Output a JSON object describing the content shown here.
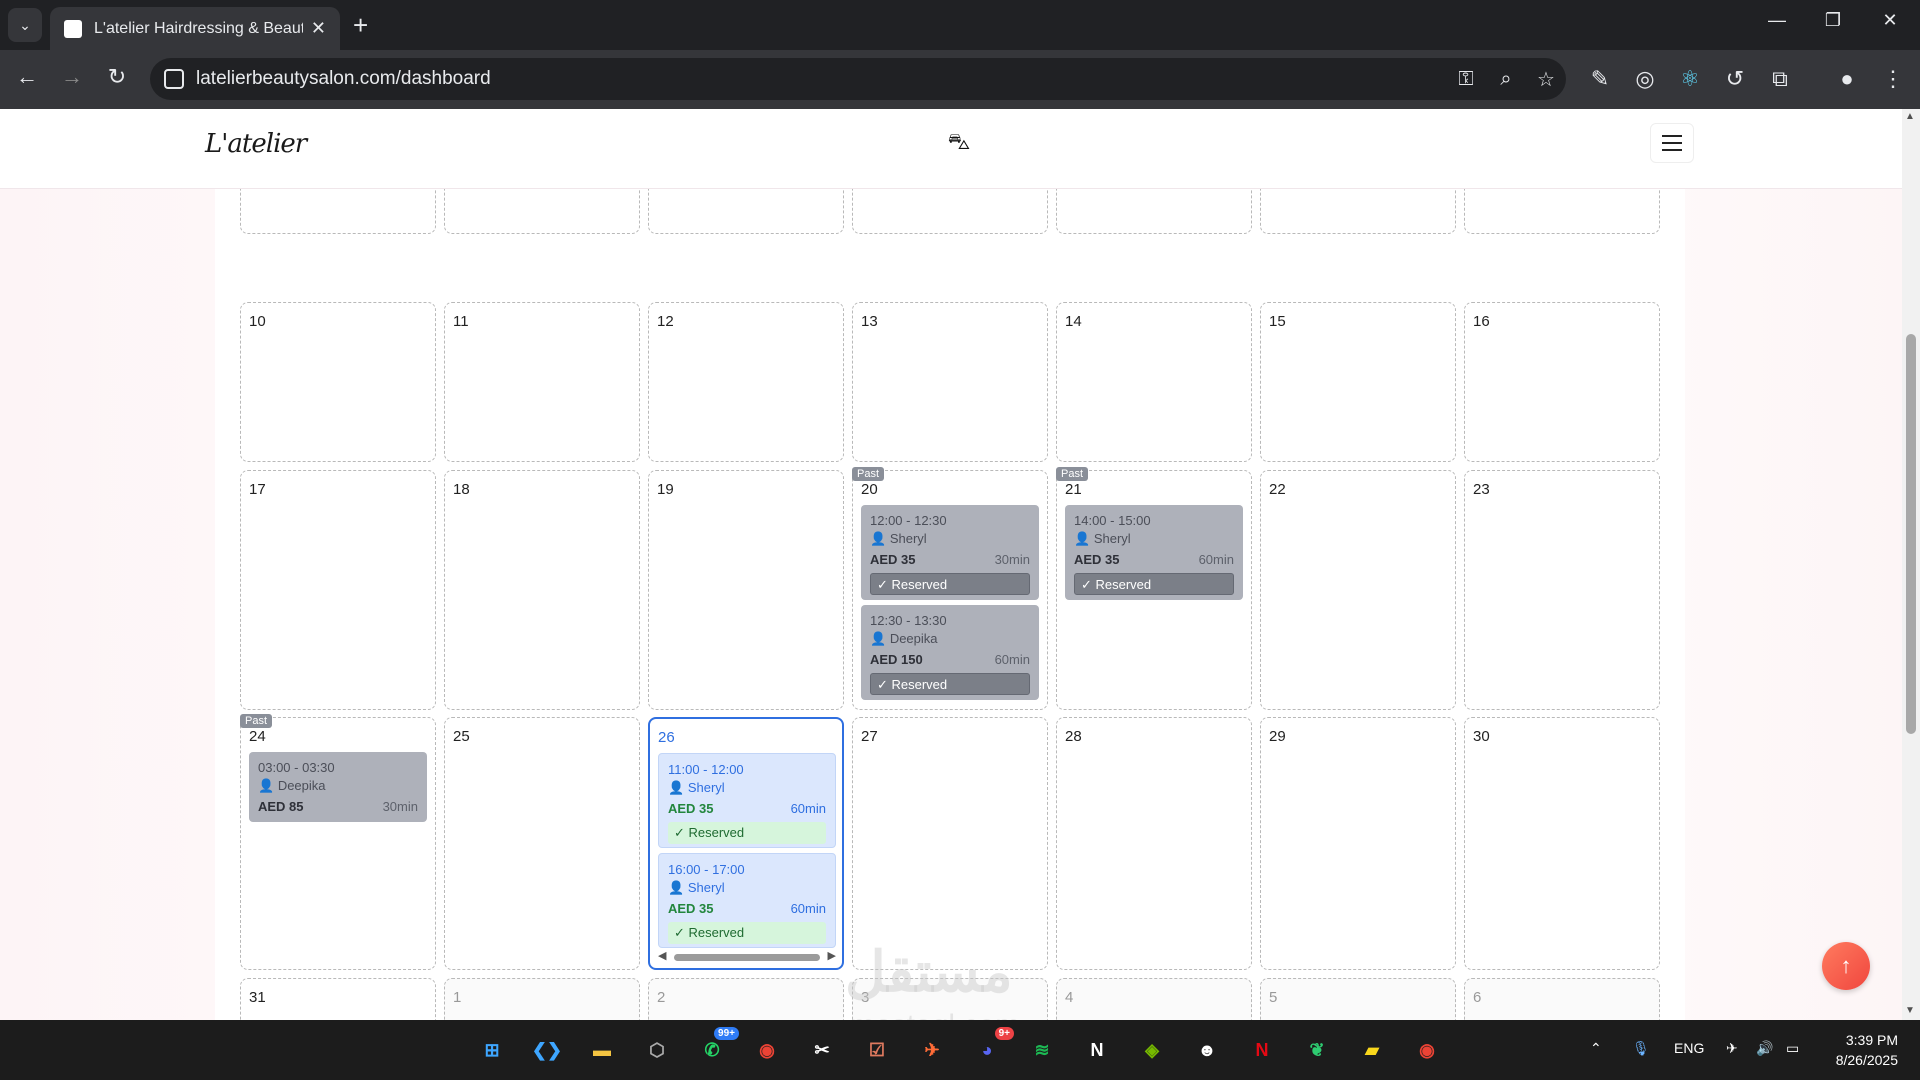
{
  "browser": {
    "tab_title": "L'atelier Hairdressing & Beauty",
    "url": "latelierbeautysalon.com/dashboard"
  },
  "site": {
    "logo": "L'atelier"
  },
  "calendar": {
    "rows": [
      {
        "days": [
          {
            "num": "",
            "muted": false
          },
          {
            "num": "",
            "muted": false
          },
          {
            "num": "",
            "muted": false
          },
          {
            "num": "",
            "muted": false
          },
          {
            "num": "",
            "muted": false
          },
          {
            "num": "",
            "muted": false
          },
          {
            "num": "",
            "muted": false
          }
        ]
      },
      {
        "days": [
          {
            "num": "10"
          },
          {
            "num": "11"
          },
          {
            "num": "12"
          },
          {
            "num": "13"
          },
          {
            "num": "14"
          },
          {
            "num": "15"
          },
          {
            "num": "16"
          }
        ]
      },
      {
        "days": [
          {
            "num": "17"
          },
          {
            "num": "18"
          },
          {
            "num": "19"
          },
          {
            "num": "20",
            "past": true,
            "appointments": [
              {
                "time": "12:00 - 12:30",
                "client": "Sheryl",
                "price": "AED 35",
                "duration": "30min",
                "status": "✓ Reserved",
                "kind": "past"
              },
              {
                "time": "12:30 - 13:30",
                "client": "Deepika",
                "price": "AED 150",
                "duration": "60min",
                "status": "✓ Reserved",
                "kind": "past"
              }
            ]
          },
          {
            "num": "21",
            "past": true,
            "appointments": [
              {
                "time": "14:00 - 15:00",
                "client": "Sheryl",
                "price": "AED 35",
                "duration": "60min",
                "status": "✓ Reserved",
                "kind": "past"
              }
            ]
          },
          {
            "num": "22"
          },
          {
            "num": "23"
          }
        ]
      },
      {
        "days": [
          {
            "num": "24",
            "past": true,
            "appointments": [
              {
                "time": "03:00 - 03:30",
                "client": "Deepika",
                "price": "AED 85",
                "duration": "30min",
                "status": "",
                "kind": "past"
              }
            ]
          },
          {
            "num": "25"
          },
          {
            "num": "26",
            "today": true,
            "appointments": [
              {
                "time": "11:00 - 12:00",
                "client": "Sheryl",
                "price": "AED 35",
                "duration": "60min",
                "status": "✓ Reserved",
                "kind": "future"
              },
              {
                "time": "16:00 - 17:00",
                "client": "Sheryl",
                "price": "AED 35",
                "duration": "60min",
                "status": "✓ Reserved",
                "kind": "future"
              }
            ]
          },
          {
            "num": "27"
          },
          {
            "num": "28"
          },
          {
            "num": "29"
          },
          {
            "num": "30"
          }
        ]
      },
      {
        "days": [
          {
            "num": "31"
          },
          {
            "num": "1",
            "muted": true
          },
          {
            "num": "2",
            "muted": true
          },
          {
            "num": "3",
            "muted": true
          },
          {
            "num": "4",
            "muted": true
          },
          {
            "num": "5",
            "muted": true
          },
          {
            "num": "6",
            "muted": true
          }
        ]
      }
    ],
    "past_label": "Past"
  },
  "watermark": {
    "arabic": "مستقل",
    "latin": "mostaql.com"
  },
  "taskbar": {
    "whatsapp_badge": "99+",
    "discord_badge": "9+",
    "lang": "ENG",
    "time": "3:39 PM",
    "date": "8/26/2025"
  }
}
